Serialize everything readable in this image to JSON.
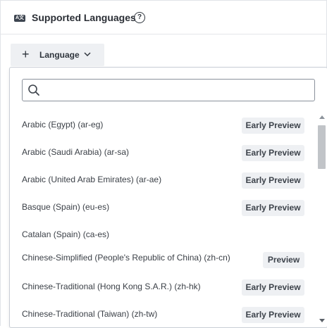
{
  "header": {
    "title": "Supported Languages",
    "icon": "language-icon",
    "icon_text": "A文",
    "help_icon": "question-circle-icon",
    "help_glyph": "?"
  },
  "add_button": {
    "plus_glyph": "+",
    "label": "Language",
    "icon": "chevron-down-icon"
  },
  "search": {
    "value": "",
    "placeholder": "",
    "icon": "search-icon"
  },
  "languages": [
    {
      "name": "Arabic (Egypt) (ar-eg)",
      "badge": "Early Preview"
    },
    {
      "name": "Arabic (Saudi Arabia) (ar-sa)",
      "badge": "Early Preview"
    },
    {
      "name": "Arabic (United Arab Emirates) (ar-ae)",
      "badge": "Early Preview"
    },
    {
      "name": "Basque (Spain) (eu-es)",
      "badge": "Early Preview"
    },
    {
      "name": "Catalan (Spain) (ca-es)",
      "badge": ""
    },
    {
      "name": "Chinese-Simplified (People's Republic of China) (zh-cn)",
      "badge": "Preview"
    },
    {
      "name": "Chinese-Traditional (Hong Kong S.A.R.) (zh-hk)",
      "badge": "Early Preview"
    },
    {
      "name": "Chinese-Traditional (Taiwan) (zh-tw)",
      "badge": "Early Preview"
    }
  ],
  "colors": {
    "badge_bg": "#eef0f3",
    "text": "#3a3f46",
    "border": "#c9ced6"
  }
}
